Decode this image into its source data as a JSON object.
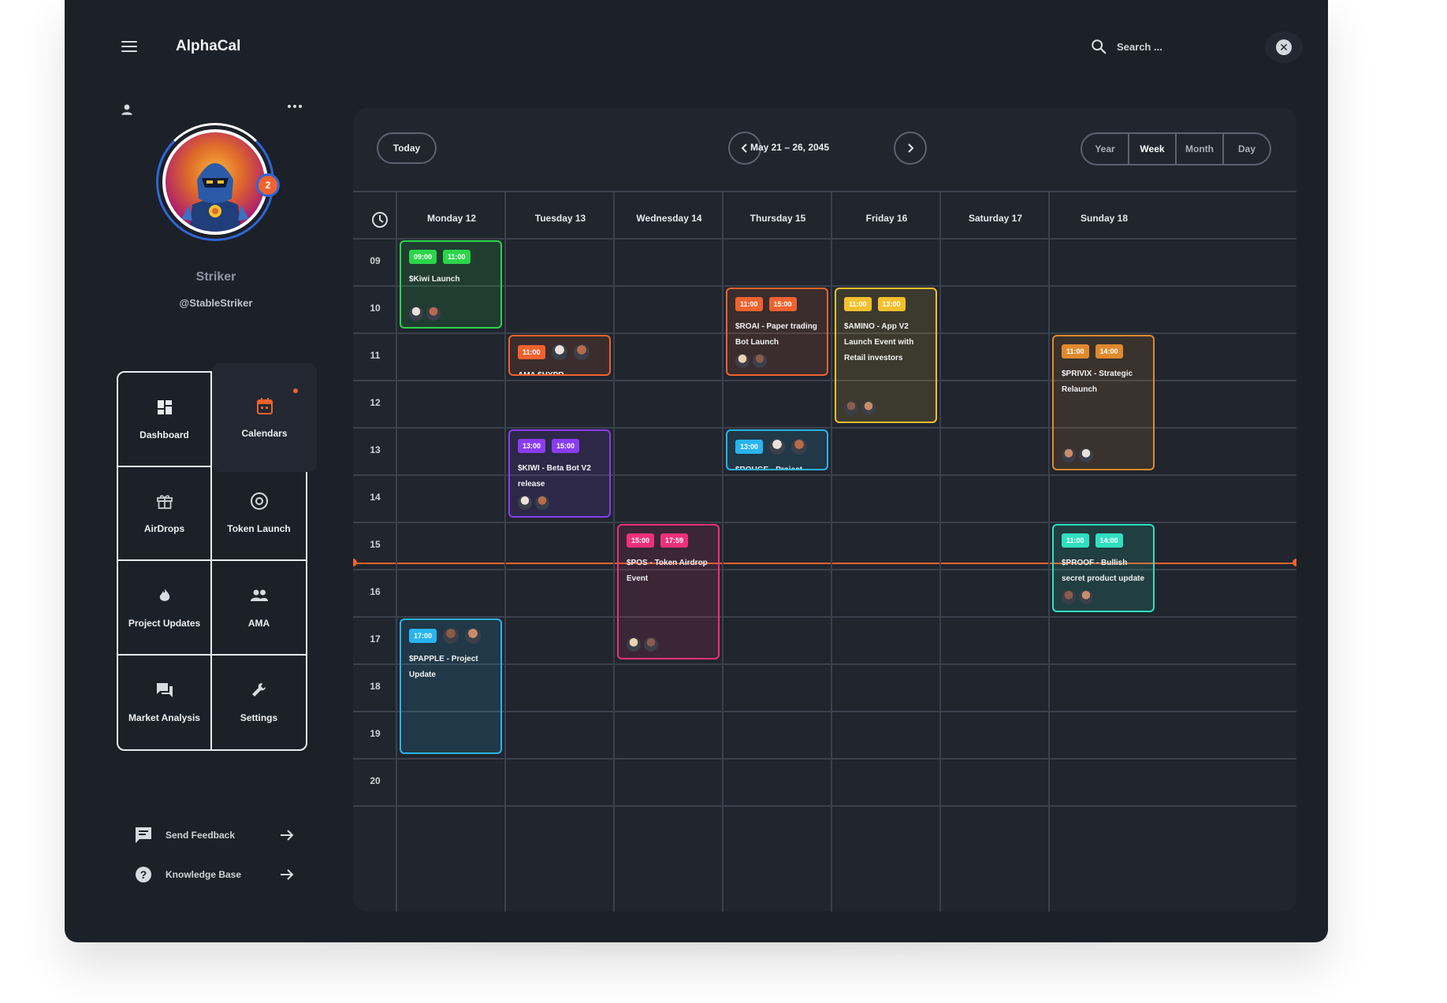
{
  "app": {
    "title": "AlphaCal",
    "search_placeholder": "Search ..."
  },
  "profile": {
    "name": "Striker",
    "handle": "@StableStriker",
    "notifications": "2"
  },
  "nav": [
    {
      "label": "Dashboard",
      "icon": "dashboard-icon",
      "active": false
    },
    {
      "label": "Calendars",
      "icon": "calendar-icon",
      "active": true
    },
    {
      "label": "AirDrops",
      "icon": "gift-icon",
      "active": false
    },
    {
      "label": "Token Launch",
      "icon": "target-icon",
      "active": false
    },
    {
      "label": "Project Updates",
      "icon": "flame-icon",
      "active": false
    },
    {
      "label": "AMA",
      "icon": "people-icon",
      "active": false
    },
    {
      "label": "Market Analysis",
      "icon": "chat-icon",
      "active": false
    },
    {
      "label": "Settings",
      "icon": "wrench-icon",
      "active": false
    }
  ],
  "footer_links": [
    {
      "label": "Send Feedback",
      "icon": "feedback-icon"
    },
    {
      "label": "Knowledge Base",
      "icon": "help-icon"
    }
  ],
  "toolbar": {
    "today": "Today",
    "date_range": "May 21 – 26, 2045",
    "views": [
      "Year",
      "Week",
      "Month",
      "Day"
    ],
    "active_view": "Week"
  },
  "days": [
    "Monday 12",
    "Tuesday 13",
    "Wednesday 14",
    "Thursday 15",
    "Friday 16",
    "Saturday 17",
    "Sunday 18"
  ],
  "hours": [
    "09",
    "10",
    "11",
    "12",
    "13",
    "14",
    "15",
    "16",
    "17",
    "18",
    "19",
    "20"
  ],
  "colors": {
    "green": "#2bd64b",
    "orange": "#f0622e",
    "amber": "#f5c02c",
    "purple": "#8a3cf0",
    "blue": "#29b4f0",
    "pink": "#f0307a",
    "teal": "#2fe0c0",
    "ochre": "#e08a2c",
    "accent": "#f0622e"
  },
  "events": [
    {
      "title": "$Kiwi Launch",
      "start": "09:00",
      "end": "11:00",
      "color": "green",
      "day": "Monday 12"
    },
    {
      "title": "AMA $HYPR",
      "start": "11:00",
      "end": "",
      "color": "orange",
      "day": "Tuesday 13"
    },
    {
      "title": "$ROAI - Paper trading Bot Launch",
      "start": "11:00",
      "end": "15:00",
      "color": "orange",
      "day": "Thursday 15"
    },
    {
      "title": "$AMINO - App V2 Launch Event with Retail investors",
      "start": "11:00",
      "end": "13:00",
      "color": "amber",
      "day": "Friday 16"
    },
    {
      "title": "$PRIVIX - Strategic Relaunch",
      "start": "11:00",
      "end": "14:00",
      "color": "ochre",
      "day": "Sunday 18"
    },
    {
      "title": "$KIWI - Beta Bot V2 release",
      "start": "13:00",
      "end": "15:00",
      "color": "purple",
      "day": "Tuesday 13"
    },
    {
      "title": "$ROUGE - Project Update",
      "start": "13:00",
      "end": "",
      "color": "blue",
      "day": "Thursday 15"
    },
    {
      "title": "$POS - Token Airdrop Event",
      "start": "15:00",
      "end": "17:59",
      "color": "pink",
      "day": "Wednesday 14"
    },
    {
      "title": "$PROOF - Bullish secret product update",
      "start": "11:00",
      "end": "14:00",
      "color": "teal",
      "day": "Sunday 18"
    },
    {
      "title": "$PAPPLE - Project Update",
      "start": "17:00",
      "end": "",
      "color": "blue",
      "day": "Monday 12"
    }
  ]
}
